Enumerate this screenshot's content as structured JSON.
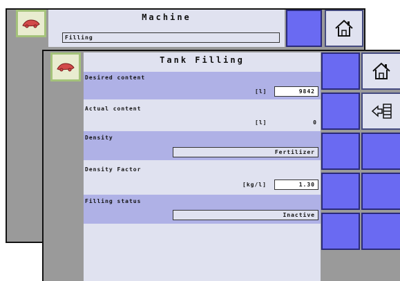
{
  "back_screen": {
    "title": "Machine",
    "field_value": "Filling"
  },
  "front_screen": {
    "title": "Tank Filling",
    "rows": [
      {
        "label": "Desired content",
        "unit": "[l]",
        "value": "9842"
      },
      {
        "label": "Actual content",
        "unit": "[l]",
        "value": "0"
      },
      {
        "label": "Density",
        "unit": "",
        "value": "Fertilizer"
      },
      {
        "label": "Density Factor",
        "unit": "[kg/l]",
        "value": "1.30"
      },
      {
        "label": "Filling status",
        "unit": "",
        "value": "Inactive"
      }
    ]
  },
  "icons": [
    "sprayer-logo-icon",
    "home-icon",
    "exit-arrow-icon"
  ],
  "colors": {
    "background": "#ffffff",
    "nav_gray": "#9a9a9a",
    "panel": "#e0e2f0",
    "row_highlight": "#afb1e6",
    "softkey": "#6a6af2",
    "softkey_border": "#2a2a7a",
    "logo_border": "#a4c27a",
    "logo_icon": "#d24a4a"
  }
}
